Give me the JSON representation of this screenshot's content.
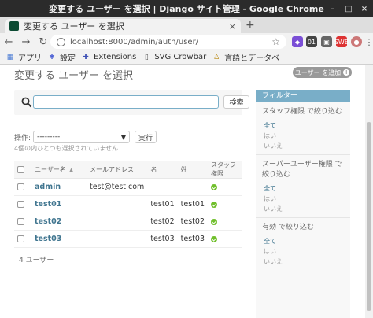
{
  "window": {
    "title": "変更する ユーザー を選択 | Django サイト管理 - Google Chrome"
  },
  "tab": {
    "title": "変更する ユーザー を選択"
  },
  "address": {
    "url": "localhost:8000/admin/auth/user/"
  },
  "extensions": [
    "01",
    "SWB"
  ],
  "bookmarks": [
    {
      "label": "アプリ",
      "icon": "apps-grid-icon"
    },
    {
      "label": "設定",
      "icon": "gear-icon"
    },
    {
      "label": "Extensions",
      "icon": "puzzle-icon"
    },
    {
      "label": "SVG Crowbar",
      "icon": "document-icon"
    },
    {
      "label": "言語とデータベ",
      "icon": "flask-icon"
    }
  ],
  "page": {
    "heading": "変更する ユーザー を選択",
    "add_label": "ユーザー を追加",
    "search_button": "検索",
    "actions_label": "操作:",
    "action_select": "---------",
    "run_button": "実行",
    "selection_counter": "4個の内ひとつも選択されていません",
    "columns": [
      "ユーザー名",
      "メールアドレス",
      "名",
      "姓",
      "スタッフ権限"
    ],
    "rows": [
      {
        "username": "admin",
        "email": "test@test.com",
        "first": "",
        "last": "",
        "staff": true
      },
      {
        "username": "test01",
        "email": "",
        "first": "test01",
        "last": "test01",
        "staff": true
      },
      {
        "username": "test02",
        "email": "",
        "first": "test02",
        "last": "test02",
        "staff": true
      },
      {
        "username": "test03",
        "email": "",
        "first": "test03",
        "last": "test03",
        "staff": true
      }
    ],
    "paginator": "4 ユーザー"
  },
  "filter": {
    "title": "フィルター",
    "groups": [
      {
        "title": "スタッフ権限 で絞り込む",
        "options": [
          "全て",
          "はい",
          "いいえ"
        ],
        "selected": 0
      },
      {
        "title": "スーパーユーザー権限 で絞り込む",
        "options": [
          "全て",
          "はい",
          "いいえ"
        ],
        "selected": 0
      },
      {
        "title": "有効 で絞り込む",
        "options": [
          "全て",
          "はい",
          "いいえ"
        ],
        "selected": 0
      }
    ]
  },
  "colors": {
    "accent": "#79aec8",
    "link": "#417690",
    "check": "#70bf2b"
  }
}
